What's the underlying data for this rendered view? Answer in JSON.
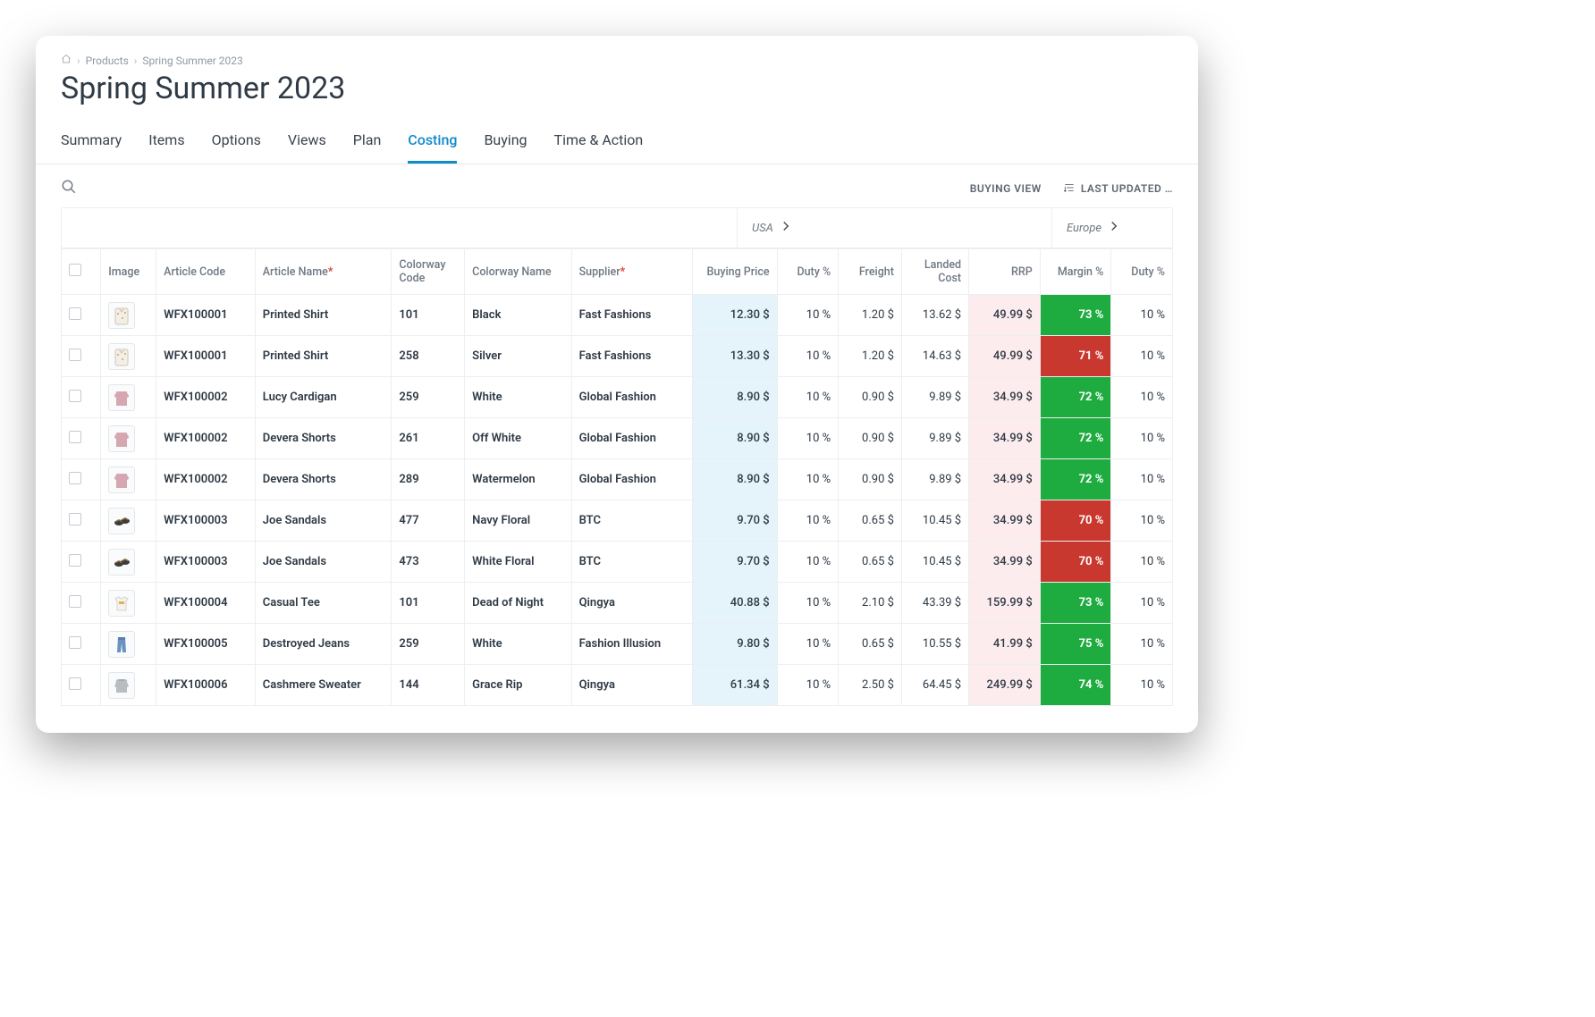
{
  "breadcrumb": {
    "products": "Products",
    "season": "Spring Summer 2023"
  },
  "page_title": "Spring Summer 2023",
  "tabs": [
    "Summary",
    "Items",
    "Options",
    "Views",
    "Plan",
    "Costing",
    "Buying",
    "Time & Action"
  ],
  "active_tab": "Costing",
  "toolbar": {
    "buying_view": "BUYING VIEW",
    "last_updated": "LAST UPDATED …"
  },
  "regions": {
    "usa": "USA",
    "europe": "Europe"
  },
  "columns": {
    "image": "Image",
    "article_code": "Article Code",
    "article_name": "Article Name",
    "colorway_code": "Colorway Code",
    "colorway_name": "Colorway Name",
    "supplier": "Supplier",
    "buying_price": "Buying Price",
    "duty": "Duty %",
    "freight": "Freight",
    "landed": "Landed Cost",
    "rrp": "RRP",
    "margin": "Margin %",
    "duty2": "Duty %"
  },
  "rows": [
    {
      "thumb": "shirt",
      "code": "WFX100001",
      "name": "Printed Shirt",
      "cwcode": "101",
      "cwname": "Black",
      "supplier": "Fast Fashions",
      "buying": "12.30 $",
      "duty": "10 %",
      "freight": "1.20 $",
      "landed": "13.62 $",
      "rrp": "49.99 $",
      "margin": "73 %",
      "mclass": "green",
      "duty2": "10 %"
    },
    {
      "thumb": "shirt",
      "code": "WFX100001",
      "name": "Printed Shirt",
      "cwcode": "258",
      "cwname": "Silver",
      "supplier": "Fast Fashions",
      "buying": "13.30 $",
      "duty": "10 %",
      "freight": "1.20 $",
      "landed": "14.63 $",
      "rrp": "49.99 $",
      "margin": "71 %",
      "mclass": "red",
      "duty2": "10 %"
    },
    {
      "thumb": "cardigan",
      "code": "WFX100002",
      "name": "Lucy Cardigan",
      "cwcode": "259",
      "cwname": "White",
      "supplier": "Global Fashion",
      "buying": "8.90 $",
      "duty": "10 %",
      "freight": "0.90 $",
      "landed": "9.89 $",
      "rrp": "34.99 $",
      "margin": "72 %",
      "mclass": "green",
      "duty2": "10 %"
    },
    {
      "thumb": "cardigan",
      "code": "WFX100002",
      "name": "Devera Shorts",
      "cwcode": "261",
      "cwname": "Off White",
      "supplier": "Global Fashion",
      "buying": "8.90 $",
      "duty": "10 %",
      "freight": "0.90 $",
      "landed": "9.89 $",
      "rrp": "34.99 $",
      "margin": "72 %",
      "mclass": "green",
      "duty2": "10 %"
    },
    {
      "thumb": "cardigan",
      "code": "WFX100002",
      "name": "Devera Shorts",
      "cwcode": "289",
      "cwname": "Watermelon",
      "supplier": "Global Fashion",
      "buying": "8.90 $",
      "duty": "10 %",
      "freight": "0.90 $",
      "landed": "9.89 $",
      "rrp": "34.99 $",
      "margin": "72 %",
      "mclass": "green",
      "duty2": "10 %"
    },
    {
      "thumb": "sandals",
      "code": "WFX100003",
      "name": "Joe Sandals",
      "cwcode": "477",
      "cwname": "Navy Floral",
      "supplier": "BTC",
      "buying": "9.70 $",
      "duty": "10 %",
      "freight": "0.65 $",
      "landed": "10.45 $",
      "rrp": "34.99 $",
      "margin": "70 %",
      "mclass": "red",
      "duty2": "10 %"
    },
    {
      "thumb": "sandals",
      "code": "WFX100003",
      "name": "Joe Sandals",
      "cwcode": "473",
      "cwname": "White Floral",
      "supplier": "BTC",
      "buying": "9.70 $",
      "duty": "10 %",
      "freight": "0.65 $",
      "landed": "10.45 $",
      "rrp": "34.99 $",
      "margin": "70 %",
      "mclass": "red",
      "duty2": "10 %"
    },
    {
      "thumb": "tee",
      "code": "WFX100004",
      "name": "Casual Tee",
      "cwcode": "101",
      "cwname": "Dead of Night",
      "supplier": "Qingya",
      "buying": "40.88 $",
      "duty": "10 %",
      "freight": "2.10 $",
      "landed": "43.39 $",
      "rrp": "159.99 $",
      "margin": "73 %",
      "mclass": "green",
      "duty2": "10 %"
    },
    {
      "thumb": "jeans",
      "code": "WFX100005",
      "name": "Destroyed Jeans",
      "cwcode": "259",
      "cwname": "White",
      "supplier": "Fashion Illusion",
      "buying": "9.80 $",
      "duty": "10 %",
      "freight": "0.65 $",
      "landed": "10.55 $",
      "rrp": "41.99 $",
      "margin": "75 %",
      "mclass": "green",
      "duty2": "10 %"
    },
    {
      "thumb": "sweater",
      "code": "WFX100006",
      "name": "Cashmere Sweater",
      "cwcode": "144",
      "cwname": "Grace Rip",
      "supplier": "Qingya",
      "buying": "61.34 $",
      "duty": "10 %",
      "freight": "2.50 $",
      "landed": "64.45 $",
      "rrp": "249.99 $",
      "margin": "74 %",
      "mclass": "green",
      "duty2": "10 %"
    }
  ],
  "thumbs": {
    "shirt": "<rect x='4' y='3' width='14' height='18' rx='2' fill='#f3efe6' stroke='#cfc7b5'/><path d='M8 3 L11 7 L14 3' fill='#e8e2d4' stroke='#cfc7b5'/><circle cx='7' cy='9' r='1' fill='#c7a26b'/><circle cx='12' cy='14' r='1' fill='#c7a26b'/><circle cx='15' cy='8' r='1' fill='#c7a26b'/>",
    "cardigan": "<path d='M5 6 Q4 4 7 4 L15 4 Q18 4 17 6 L17 20 L5 20 Z' fill='#d6a7b0'/><path d='M5 6 Q3 7 3 10 L5 11 Z' fill='#d6a7b0'/><path d='M17 6 Q19 7 19 10 L17 11 Z' fill='#d6a7b0'/>",
    "sandals": "<ellipse cx='8' cy='13' rx='5' ry='3' fill='#3b3b3b'/><ellipse cx='15' cy='11' rx='5' ry='3' fill='#3b3b3b'/><path d='M5 12 Q8 8 11 12' stroke='#8a6a3a' fill='none' stroke-width='1.5'/><path d='M12 10 Q15 6 18 10' stroke='#8a6a3a' fill='none' stroke-width='1.5'/>",
    "tee": "<path d='M4 6 L8 4 L11 6 L14 4 L18 6 L16 9 L16 19 L6 19 L6 9 Z' fill='#f5f3ee' stroke='#d8d4ca'/><rect x='8' y='9' width='6' height='3' fill='#e0b05a'/>",
    "jeans": "<path d='M7 3 L15 3 L16 20 L12 20 L11 10 L10 20 L6 20 Z' fill='#6b93c2'/><path d='M7 3 L15 3 L15 6 L7 6 Z' fill='#5a7fa9'/>",
    "sweater": "<path d='M5 7 Q4 4 8 4 L14 4 Q18 4 17 7 L17 19 L5 19 Z' fill='#b9bcc0'/><path d='M5 7 L3 12 L5 13 Z' fill='#b9bcc0'/><path d='M17 7 L19 12 L17 13 Z' fill='#b9bcc0'/><rect x='8' y='4' width='6' height='2' fill='#a7aab0'/>"
  }
}
